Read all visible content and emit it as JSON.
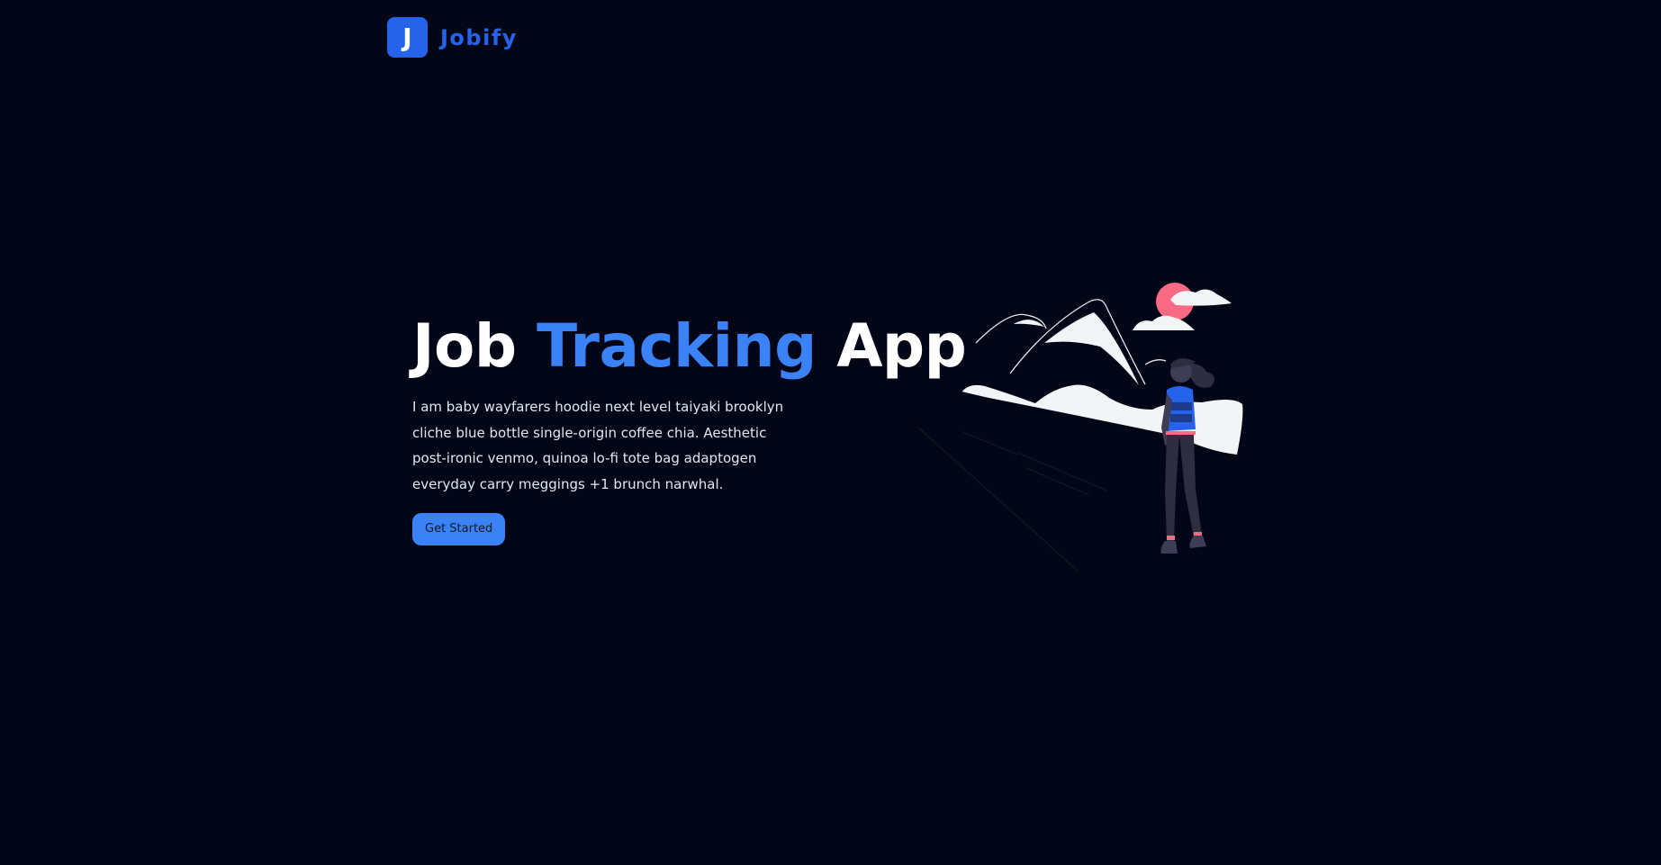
{
  "brand": {
    "logo_letter": "J",
    "name": "Jobify",
    "accent_color": "#2563eb"
  },
  "hero": {
    "title_start": "Job ",
    "title_accent": "Tracking",
    "title_end": " App",
    "description": "I am baby wayfarers hoodie next level taiyaki brooklyn cliche blue bottle single-origin coffee chia. Aesthetic post-ironic venmo, quinoa lo-fi tote bag adaptogen everyday carry meggings +1 brunch narwhal.",
    "cta_label": "Get Started"
  },
  "illustration": {
    "icon": "hiker-mountains-illustration",
    "sun_color": "#fb6a85",
    "accent_color": "#2563eb"
  },
  "theme": {
    "background": "#020617",
    "text": "#ffffff",
    "muted_text": "#e2e8f0",
    "primary": "#3b82f6"
  }
}
